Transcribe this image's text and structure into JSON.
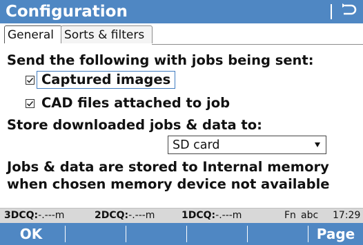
{
  "window": {
    "title": "Configuration",
    "back_icon": "back-return-icon"
  },
  "tabs": [
    {
      "label": "General",
      "active": true
    },
    {
      "label": "Sorts & filters",
      "active": false
    }
  ],
  "send_section": {
    "heading": "Send the following with jobs being sent:",
    "options": [
      {
        "label": "Captured images",
        "checked": true,
        "focused": true
      },
      {
        "label": "CAD files attached to job",
        "checked": true,
        "focused": false
      }
    ]
  },
  "store_section": {
    "heading": "Store downloaded jobs & data to:",
    "select_value": "SD card"
  },
  "note": {
    "line1": "Jobs & data are stored to Internal memory",
    "line2": "when chosen memory device not available"
  },
  "status": {
    "dcq3_label": "3DCQ:",
    "dcq3_value": "-.---m",
    "dcq2_label": "2DCQ:",
    "dcq2_value": "-.---m",
    "dcq1_label": "1DCQ:",
    "dcq1_value": "-.---m",
    "fn": "Fn",
    "input_mode": "abc",
    "time": "17:29"
  },
  "softkeys": {
    "f1": "OK",
    "f6": "Page"
  },
  "colors": {
    "accent": "#4f87c3",
    "status_bg": "#d8d8d8",
    "focus": "#3f7bc0"
  }
}
